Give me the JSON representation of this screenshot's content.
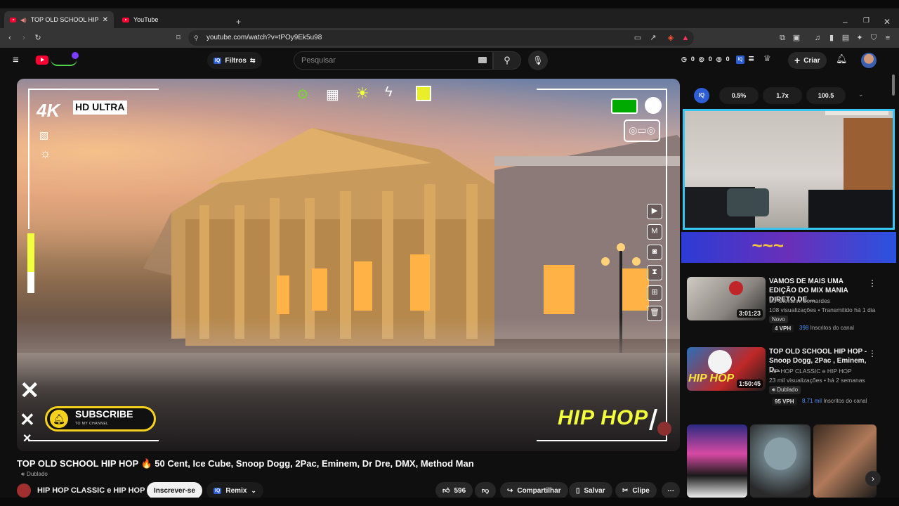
{
  "browser": {
    "tabs": [
      {
        "title": "TOP OLD SCHOOL HIP HOP 🔥 ...",
        "active": true
      },
      {
        "title": "YouTube",
        "active": false
      }
    ],
    "url": "youtube.com/watch?v=tPOy9Ek5u98"
  },
  "header": {
    "filters_label": "Filtros",
    "search_placeholder": "Pesquisar",
    "counters": [
      "0",
      "0",
      "0"
    ],
    "create_label": "Criar"
  },
  "player": {
    "badge_hd": "HD ULTRA",
    "badge_4k": "4K",
    "subscribe_text": "SUBSCRIBE",
    "subscribe_sub": "TO MY CHANNEL",
    "watermark": "HIP HOP"
  },
  "iq": {
    "label": "IQ",
    "values": [
      "0.5%",
      "1.7x",
      "100.5"
    ]
  },
  "video": {
    "title": "TOP OLD SCHOOL HIP HOP 🔥 50 Cent, Ice Cube, Snoop Dogg, 2Pac, Eminem, Dr Dre, DMX, Method Man",
    "dubbed": "Dublado",
    "channel": "HIP HOP CLASSIC e HIP HOP",
    "subscribe_btn": "Inscrever-se",
    "remix": "Remix",
    "likes": "596",
    "share": "Compartilhar",
    "save": "Salvar",
    "clip": "Clipe"
  },
  "recommendations": [
    {
      "title": "VAMOS  DE MAIS UMA EDIÇÃO DO MIX MANIA DIRETO DE ...",
      "channel": "DJ Giovanni bernardes",
      "meta": "108 visualizações • Transmitido há 1 dia",
      "tag": "Novo",
      "vph": "4 VPH",
      "subs_count": "398",
      "subs_label": "Inscritos do canal",
      "duration": "3:01:23"
    },
    {
      "title": "TOP OLD SCHOOL HIP HOP - Snoop Dogg, 2Pac , Eminem, D...",
      "channel": "HIP HOP CLASSIC e HIP HOP",
      "meta": "23 mil visualizações • há 2 semanas",
      "tag": "Dublado",
      "vph": "95 VPH",
      "subs_count": "8,71 mil",
      "subs_label": "Inscritos do canal",
      "duration": "1:50:45",
      "thumb_text": "HIP HOP"
    }
  ],
  "colors": {
    "accent": "#38c6f2",
    "brand_red": "#ff0033",
    "subscribe_yellow": "#f7d21c",
    "watermark_yellow": "#f2ff3c"
  }
}
